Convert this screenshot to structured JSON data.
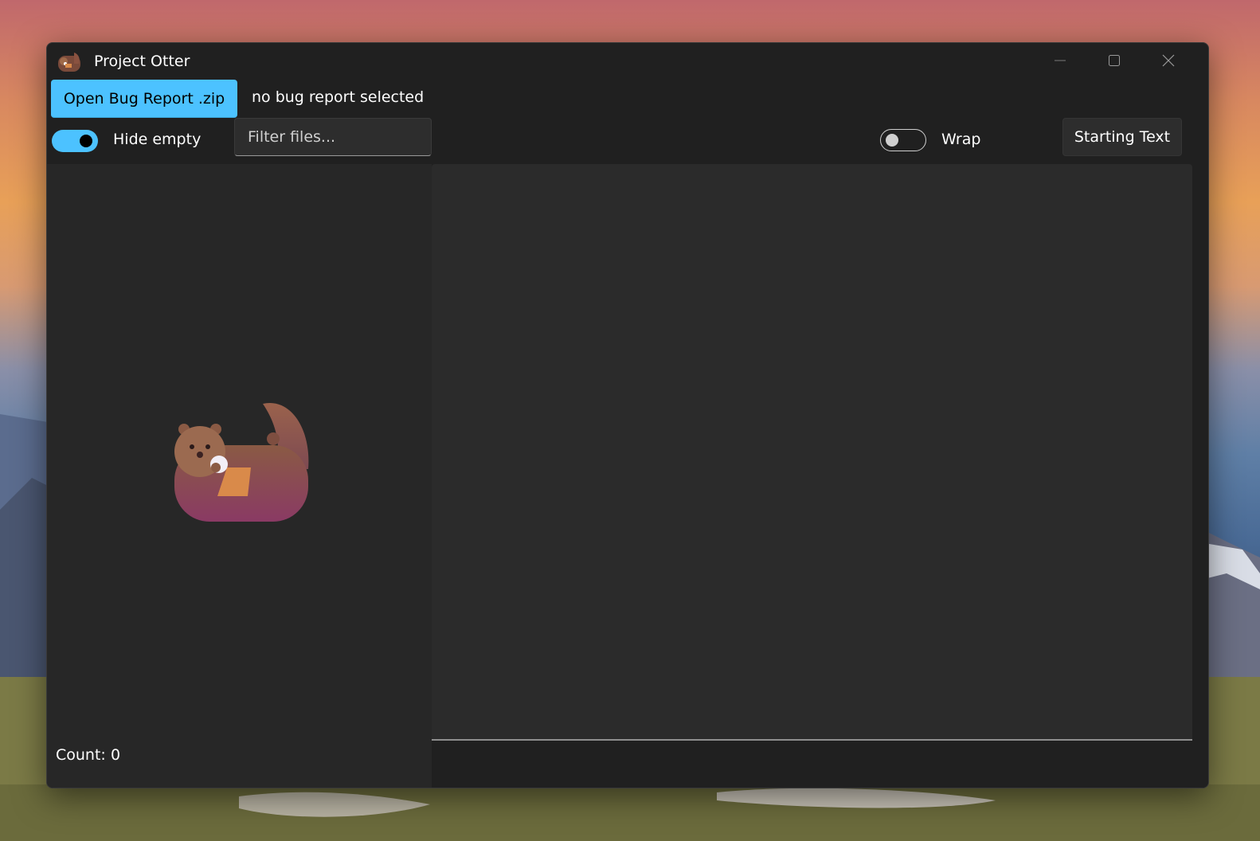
{
  "window": {
    "title": "Project Otter",
    "icon": "otter-icon"
  },
  "caption_buttons": {
    "minimize_icon": "minimize-icon",
    "maximize_icon": "maximize-icon",
    "close_icon": "close-icon"
  },
  "toolbar": {
    "open_label": "Open Bug Report .zip",
    "report_status": "no bug report selected",
    "hide_empty": {
      "label": "Hide empty",
      "checked": true
    },
    "filter": {
      "placeholder": "Filter files...",
      "value": ""
    },
    "wrap": {
      "label": "Wrap",
      "checked": false
    },
    "starting_text_label": "Starting Text"
  },
  "file_list": {
    "empty_illustration": "otter-illustration",
    "count_label": "Count:",
    "count_value": "0"
  },
  "colors": {
    "accent": "#4cc2ff",
    "window_bg": "#202020",
    "pane_bg": "#272727",
    "content_bg": "#2b2b2b"
  }
}
